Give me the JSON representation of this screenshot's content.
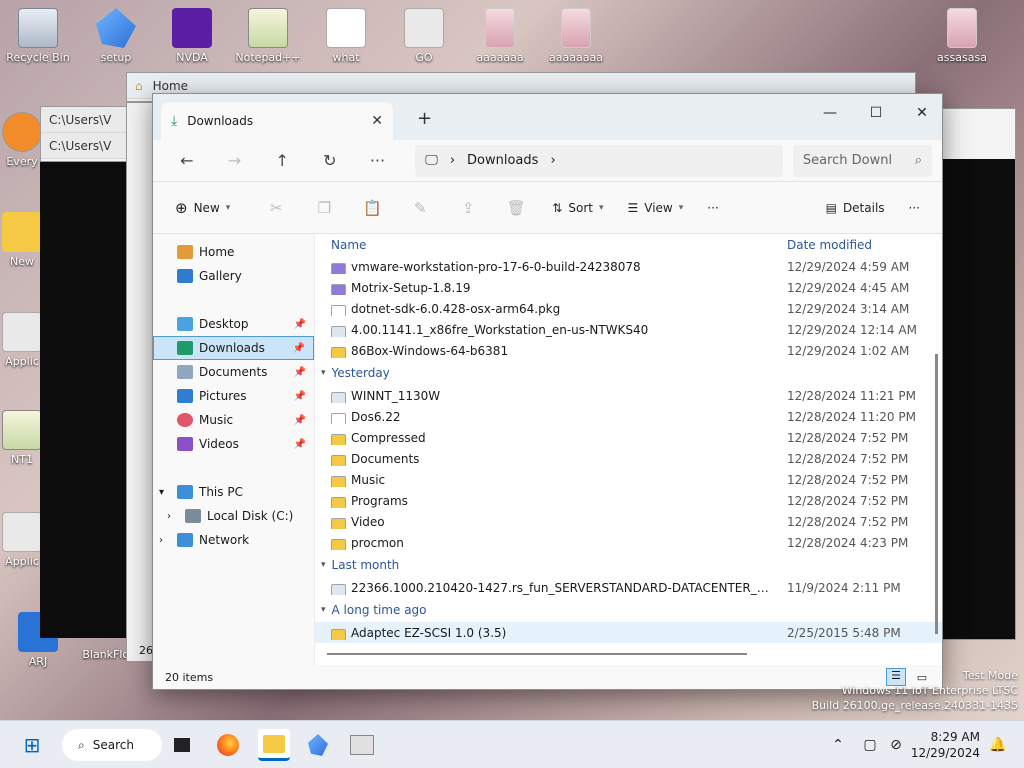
{
  "desktop": {
    "icons": [
      {
        "label": "Recycle Bin"
      },
      {
        "label": "setup"
      },
      {
        "label": "NVDA"
      },
      {
        "label": "Notepad++"
      },
      {
        "label": "what"
      },
      {
        "label": "GO"
      },
      {
        "label": "aaaaaaa"
      },
      {
        "label": "aaaaaaaa"
      },
      {
        "label": "assasasa"
      },
      {
        "label": "Every"
      },
      {
        "label": "New"
      },
      {
        "label": "Applic"
      },
      {
        "label": "NT1"
      },
      {
        "label": "Applic"
      },
      {
        "label": "ARJ"
      },
      {
        "label": "BlankFloppy"
      }
    ]
  },
  "bg_windows": {
    "home_tab": "Home",
    "path1": "C:\\Users\\V",
    "path2": "C:\\Users\\V",
    "badge": "26"
  },
  "window": {
    "tab_title": "Downloads",
    "tab_close": "✕",
    "new_tab": "+",
    "minimize": "—",
    "maximize": "☐",
    "close": "✕"
  },
  "address": {
    "crumb": "Downloads",
    "search_placeholder": "Search Downl"
  },
  "toolbar": {
    "new_label": "New",
    "sort_label": "Sort",
    "view_label": "View",
    "more": "···",
    "details_label": "Details"
  },
  "nav": {
    "quick": [
      {
        "label": "Home",
        "color": "#e49a3a"
      },
      {
        "label": "Gallery",
        "color": "#2e7bcf"
      }
    ],
    "pinned": [
      {
        "label": "Desktop",
        "color": "#4aa3e0"
      },
      {
        "label": "Downloads",
        "color": "#1e9a6b"
      },
      {
        "label": "Documents",
        "color": "#8fa8bf"
      },
      {
        "label": "Pictures",
        "color": "#2f7fd1"
      },
      {
        "label": "Music",
        "color": "#e0566b"
      },
      {
        "label": "Videos",
        "color": "#8b4fc7"
      }
    ],
    "this_pc": "This PC",
    "local_disk": "Local Disk (C:)",
    "network": "Network"
  },
  "columns": {
    "name": "Name",
    "date": "Date modified"
  },
  "groups": {
    "yesterday": "Yesterday",
    "last_month": "Last month",
    "long_ago": "A long time ago"
  },
  "files_today": [
    {
      "name": "vmware-workstation-pro-17-6-0-build-24238078",
      "date": "12/29/2024 4:59 AM",
      "icon": "exe"
    },
    {
      "name": "Motrix-Setup-1.8.19",
      "date": "12/29/2024 4:45 AM",
      "icon": "exe"
    },
    {
      "name": "dotnet-sdk-6.0.428-osx-arm64.pkg",
      "date": "12/29/2024 3:14 AM",
      "icon": "file"
    },
    {
      "name": "4.00.1141.1_x86fre_Workstation_en-us-NTWKS40",
      "date": "12/29/2024 12:14 AM",
      "icon": "iso"
    },
    {
      "name": "86Box-Windows-64-b6381",
      "date": "12/29/2024 1:02 AM",
      "icon": "folder"
    }
  ],
  "files_yesterday": [
    {
      "name": "WINNT_1130W",
      "date": "12/28/2024 11:21 PM",
      "icon": "iso"
    },
    {
      "name": "Dos6.22",
      "date": "12/28/2024 11:20 PM",
      "icon": "file"
    },
    {
      "name": "Compressed",
      "date": "12/28/2024 7:52 PM",
      "icon": "folder"
    },
    {
      "name": "Documents",
      "date": "12/28/2024 7:52 PM",
      "icon": "folder"
    },
    {
      "name": "Music",
      "date": "12/28/2024 7:52 PM",
      "icon": "folder"
    },
    {
      "name": "Programs",
      "date": "12/28/2024 7:52 PM",
      "icon": "folder"
    },
    {
      "name": "Video",
      "date": "12/28/2024 7:52 PM",
      "icon": "folder"
    },
    {
      "name": "procmon",
      "date": "12/28/2024 4:23 PM",
      "icon": "folder"
    }
  ],
  "files_last_month": [
    {
      "name": "22366.1000.210420-1427.rs_fun_SERVERSTANDARD-DATACENTER_OEMRET_x64fre...",
      "date": "11/9/2024 2:11 PM",
      "icon": "iso"
    }
  ],
  "files_long_ago": [
    {
      "name": "Adaptec EZ-SCSI 1.0 (3.5)",
      "date": "2/25/2015 5:48 PM",
      "icon": "folder"
    }
  ],
  "status": {
    "count": "20 items"
  },
  "watermark": {
    "line1": "Test Mode",
    "line2": "Windows 11 IoT Enterprise LTSC",
    "line3": "Build 26100.ge_release.240331-1435"
  },
  "taskbar": {
    "search_label": "Search",
    "time": "8:29 AM",
    "date": "12/29/2024"
  },
  "colors": {
    "accent": "#0067c0",
    "selection": "#cce4f7",
    "folder": "#f6c945"
  }
}
